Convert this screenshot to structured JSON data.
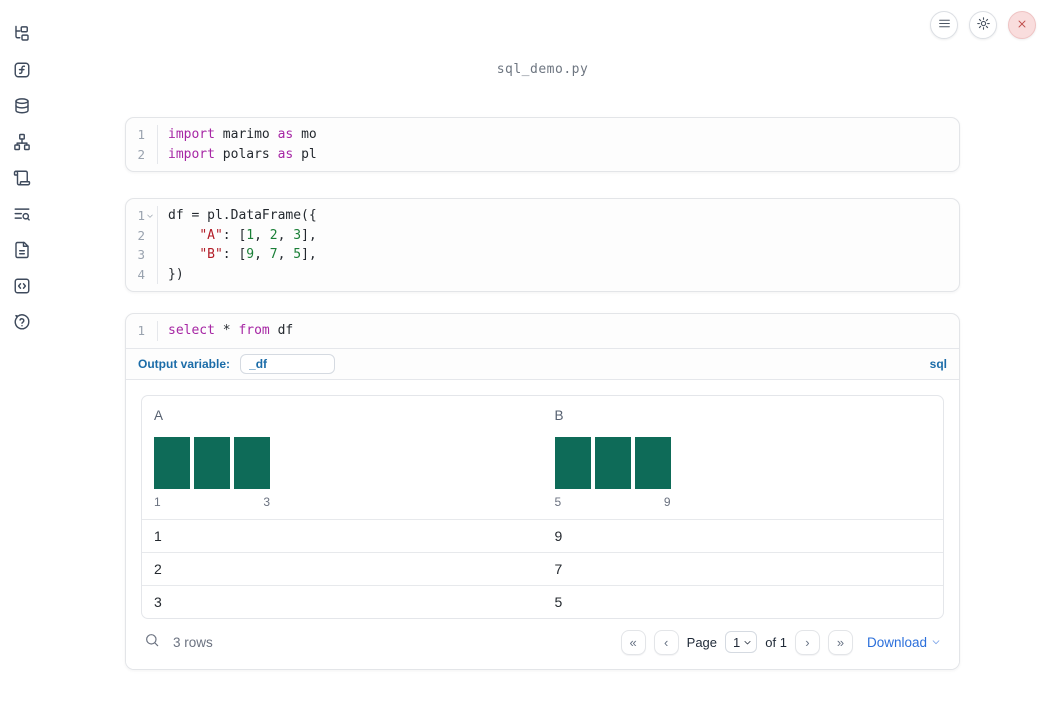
{
  "app": {
    "title": "sql_demo.py"
  },
  "colors": {
    "accent_blue": "#1b6ca8",
    "link_blue": "#2b6fdb",
    "histogram_teal": "#0e6b58",
    "keyword_purple": "#a626a4",
    "string_red": "#b31d28",
    "number_green": "#1a7f37",
    "close_red": "#c0504d"
  },
  "sidebar": {
    "items": [
      {
        "icon": "file-tree-icon"
      },
      {
        "icon": "function-square-icon"
      },
      {
        "icon": "database-icon"
      },
      {
        "icon": "network-graph-icon"
      },
      {
        "icon": "scroll-icon"
      },
      {
        "icon": "list-search-icon"
      },
      {
        "icon": "file-text-icon"
      },
      {
        "icon": "code-square-icon"
      },
      {
        "icon": "help-circle-icon"
      }
    ]
  },
  "topbar": {
    "buttons": [
      {
        "icon": "menu-icon"
      },
      {
        "icon": "gear-icon"
      },
      {
        "icon": "close-icon"
      }
    ]
  },
  "cells": [
    {
      "lines": [
        {
          "num": "1",
          "tokens": [
            {
              "t": "import",
              "c": "kw"
            },
            {
              "t": " marimo ",
              "c": "pl"
            },
            {
              "t": "as",
              "c": "kw"
            },
            {
              "t": " mo",
              "c": "pl"
            }
          ]
        },
        {
          "num": "2",
          "tokens": [
            {
              "t": "import",
              "c": "kw"
            },
            {
              "t": " polars ",
              "c": "pl"
            },
            {
              "t": "as",
              "c": "kw"
            },
            {
              "t": " pl",
              "c": "pl"
            }
          ]
        }
      ]
    },
    {
      "lines": [
        {
          "num": "1",
          "fold": true,
          "tokens": [
            {
              "t": "df = pl.DataFrame({",
              "c": "pl"
            }
          ]
        },
        {
          "num": "2",
          "tokens": [
            {
              "t": "    ",
              "c": "pl"
            },
            {
              "t": "\"A\"",
              "c": "str"
            },
            {
              "t": ": [",
              "c": "pl"
            },
            {
              "t": "1",
              "c": "num"
            },
            {
              "t": ", ",
              "c": "pl"
            },
            {
              "t": "2",
              "c": "num"
            },
            {
              "t": ", ",
              "c": "pl"
            },
            {
              "t": "3",
              "c": "num"
            },
            {
              "t": "],",
              "c": "pl"
            }
          ]
        },
        {
          "num": "3",
          "tokens": [
            {
              "t": "    ",
              "c": "pl"
            },
            {
              "t": "\"B\"",
              "c": "str"
            },
            {
              "t": ": [",
              "c": "pl"
            },
            {
              "t": "9",
              "c": "num"
            },
            {
              "t": ", ",
              "c": "pl"
            },
            {
              "t": "7",
              "c": "num"
            },
            {
              "t": ", ",
              "c": "pl"
            },
            {
              "t": "5",
              "c": "num"
            },
            {
              "t": "],",
              "c": "pl"
            }
          ]
        },
        {
          "num": "4",
          "tokens": [
            {
              "t": "})",
              "c": "pl"
            }
          ]
        }
      ]
    },
    {
      "lines": [
        {
          "num": "1",
          "tokens": [
            {
              "t": "select",
              "c": "kw"
            },
            {
              "t": " * ",
              "c": "pl"
            },
            {
              "t": "from",
              "c": "kw"
            },
            {
              "t": " df",
              "c": "pl"
            }
          ]
        }
      ]
    }
  ],
  "sql_cell": {
    "output_variable_label": "Output variable:",
    "output_variable_value": "_df",
    "language_badge": "sql"
  },
  "table": {
    "columns": [
      {
        "name": "A",
        "hist_min": "1",
        "hist_max": "3"
      },
      {
        "name": "B",
        "hist_min": "5",
        "hist_max": "9"
      }
    ],
    "histograms": [
      {
        "column": "A",
        "bar_counts": [
          1,
          1,
          1
        ],
        "range": [
          1,
          3
        ]
      },
      {
        "column": "B",
        "bar_counts": [
          1,
          1,
          1
        ],
        "range": [
          5,
          9
        ]
      }
    ],
    "rows": [
      [
        "1",
        "9"
      ],
      [
        "2",
        "7"
      ],
      [
        "3",
        "5"
      ]
    ],
    "footer": {
      "row_count": "3 rows",
      "page_label": "Page",
      "page_value": "1",
      "of_label": "of 1",
      "download_label": "Download"
    }
  }
}
